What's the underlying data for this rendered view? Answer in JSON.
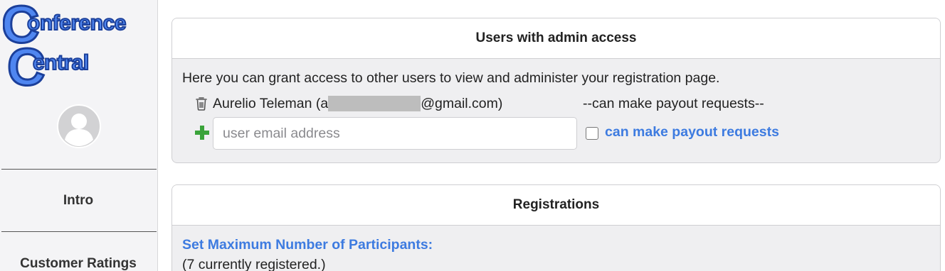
{
  "sidebar": {
    "logo": {
      "line1": "onference",
      "line2": "entral",
      "initial": "C",
      "fill": "#4f86f0",
      "stroke": "#1b3f9a"
    },
    "nav": [
      {
        "label": "Intro"
      },
      {
        "label": "Customer Ratings"
      }
    ]
  },
  "admin_card": {
    "title": "Users with admin access",
    "intro": "Here you can grant access to other users to view and administer your registration page.",
    "user": {
      "name_prefix": "Aurelio Teleman (a",
      "email_suffix": "@gmail.com)",
      "permission": "--can make payout requests--"
    },
    "new_user": {
      "placeholder": "user email address",
      "value": "",
      "checkbox_label": "can make payout requests",
      "checked": false
    }
  },
  "registrations_card": {
    "title": "Registrations",
    "max_link": "Set Maximum Number of Participants:",
    "registered_text": "(7 currently registered.)"
  },
  "colors": {
    "accent": "#3d7be0",
    "add_green": "#3aa33a",
    "redaction": "#bdbdbd"
  }
}
